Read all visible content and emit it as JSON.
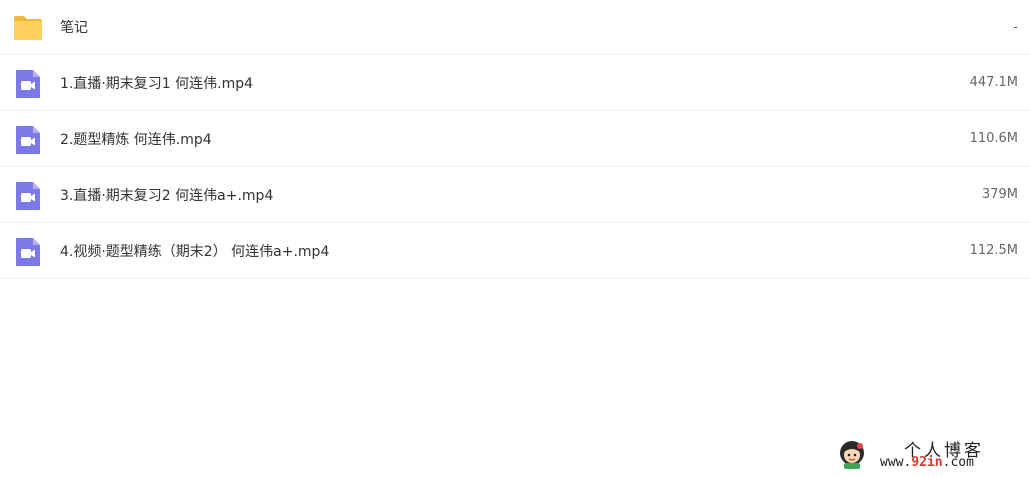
{
  "files": [
    {
      "type": "folder",
      "icon": "folder-icon",
      "name": "笔记",
      "size": "-"
    },
    {
      "type": "video",
      "icon": "video-file-icon",
      "name": "1.直播·期末复习1 何连伟.mp4",
      "size": "447.1M"
    },
    {
      "type": "video",
      "icon": "video-file-icon",
      "name": "2.题型精炼 何连伟.mp4",
      "size": "110.6M"
    },
    {
      "type": "video",
      "icon": "video-file-icon",
      "name": "3.直播·期末复习2 何连伟a+.mp4",
      "size": "379M"
    },
    {
      "type": "video",
      "icon": "video-file-icon",
      "name": "4.视频·题型精练（期末2） 何连伟a+.mp4",
      "size": "112.5M"
    }
  ],
  "watermark": {
    "title": "个人博客",
    "url_prefix": "www.",
    "url_accent": "92in",
    "url_suffix": ".com",
    "accent_color": "#d63b2f"
  },
  "colors": {
    "folder": "#ffc94d",
    "video": "#7b79e8",
    "divider": "#f0f0f0"
  }
}
